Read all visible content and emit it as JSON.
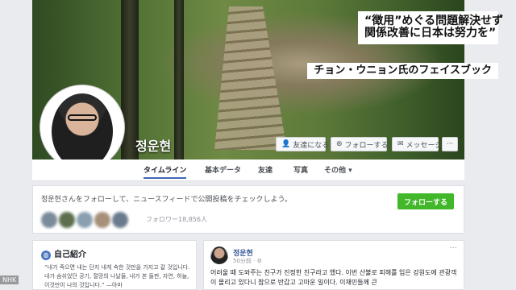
{
  "profile": {
    "name": "정운현"
  },
  "overlay": {
    "headline_line1": "“徴用”めぐる問題解決せず",
    "headline_line2": "関係改善に日本は努力を”",
    "source_caption": "チョン・ウニョン氏のフェイスブック"
  },
  "actions": {
    "friend": "友達になる",
    "follow": "フォローする",
    "message": "メッセージ",
    "more": "···",
    "friend_icon": "add-friend-icon",
    "follow_icon": "rss-icon",
    "message_icon": "messenger-icon"
  },
  "tabs": [
    "タイムライン",
    "基本データ",
    "友達",
    "写真",
    "その他 ▾"
  ],
  "follow_card": {
    "text": "정운현さんをフォローして、ニュースフィードで公開投稿をチェックしよう。",
    "button": "フォローする",
    "followers": "フォロワー18,856人"
  },
  "intro": {
    "title": "自己紹介",
    "icon": "globe-icon",
    "text": "“내가 죽으면 내는 단지 내게 속한 것만을 가지고 갈 것입니다. 내가 숨쉬었던 공기, 절망의 나날들, 내가 본 들판, 자연, 하늘, 이것만이 나의 것입니다.” —아마"
  },
  "post": {
    "author": "정운현",
    "time": "50分前 · ⚙",
    "more": "···",
    "text": "어려울 때 도와주는 친구가 진정한 친구라고 했다. 이번 산불로 피해를 입은 강원도에 관광객이 몰리고 있다니 참으로 반갑고 고마운 일이다. 이재민들께 큰"
  },
  "watermark": "NHK",
  "colors": {
    "accent": "#4267b2",
    "follow_green": "#42b72a",
    "background": "#e9ebee"
  }
}
